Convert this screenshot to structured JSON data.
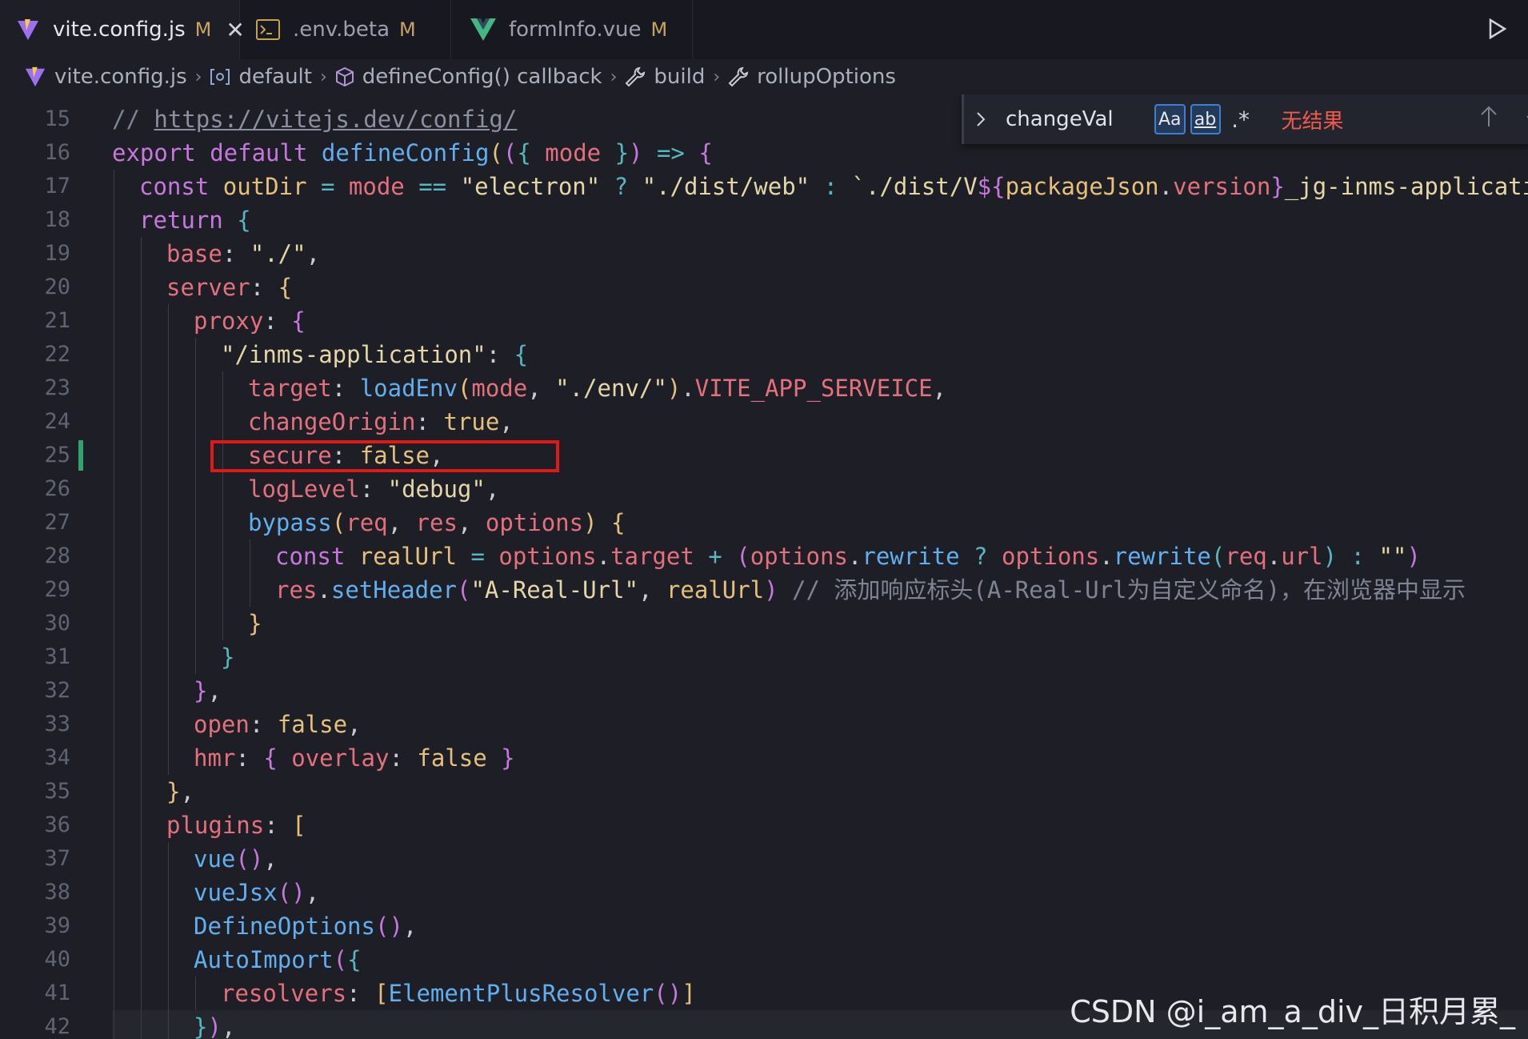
{
  "tabs": [
    {
      "label": "vite.config.js",
      "status": "M",
      "active": true,
      "icon": "vite-icon",
      "closable": true
    },
    {
      "label": ".env.beta",
      "status": "M",
      "active": false,
      "icon": "terminal-file-icon"
    },
    {
      "label": "formInfo.vue",
      "status": "M",
      "active": false,
      "icon": "vue-icon"
    }
  ],
  "breadcrumb": [
    {
      "label": "vite.config.js",
      "icon": "vite-icon"
    },
    {
      "label": "default",
      "icon": "module-icon"
    },
    {
      "label": "defineConfig() callback",
      "icon": "cube-icon"
    },
    {
      "label": "build",
      "icon": "wrench-icon"
    },
    {
      "label": "rollupOptions",
      "icon": "wrench-icon"
    }
  ],
  "find": {
    "term": "changeVal",
    "match_case": "Aa",
    "whole_word": "ab",
    "regex": ".*",
    "result": "无结果"
  },
  "lines": [
    {
      "n": "15",
      "indent": 0,
      "tokens": [
        [
          "t-cm",
          "// "
        ],
        [
          "t-url",
          "https://vitejs.dev/config/"
        ]
      ]
    },
    {
      "n": "16",
      "indent": 0,
      "tokens": [
        [
          "t-kw",
          "export "
        ],
        [
          "t-kw",
          "default "
        ],
        [
          "t-fn",
          "defineConfig"
        ],
        [
          "t-b1",
          "("
        ],
        [
          "t-b2",
          "("
        ],
        [
          "t-b3",
          "{ "
        ],
        [
          "t-prop",
          "mode"
        ],
        [
          "t-b3",
          " }"
        ],
        [
          "t-b2",
          ")"
        ],
        [
          "t-op",
          " => "
        ],
        [
          "t-b2",
          "{"
        ]
      ]
    },
    {
      "n": "17",
      "indent": 1,
      "tokens": [
        [
          "t-kw",
          "const "
        ],
        [
          "t-var",
          "outDir"
        ],
        [
          "t-op",
          " = "
        ],
        [
          "t-prop",
          "mode"
        ],
        [
          "t-op",
          " == "
        ],
        [
          "t-str",
          "\"electron\""
        ],
        [
          "t-op",
          " ? "
        ],
        [
          "t-str",
          "\"./dist/web\""
        ],
        [
          "t-op",
          " : "
        ],
        [
          "t-str",
          "`./dist/V"
        ],
        [
          "t-kw",
          "${"
        ],
        [
          "t-var",
          "packageJson"
        ],
        [
          "t-plain",
          "."
        ],
        [
          "t-prop",
          "version"
        ],
        [
          "t-kw",
          "}"
        ],
        [
          "t-str",
          "_jg-inms-application-"
        ]
      ]
    },
    {
      "n": "18",
      "indent": 1,
      "tokens": [
        [
          "t-kw",
          "return "
        ],
        [
          "t-b3",
          "{"
        ]
      ]
    },
    {
      "n": "19",
      "indent": 2,
      "tokens": [
        [
          "t-prop",
          "base"
        ],
        [
          "t-plain",
          ": "
        ],
        [
          "t-str",
          "\"./\""
        ],
        [
          "t-plain",
          ","
        ]
      ]
    },
    {
      "n": "20",
      "indent": 2,
      "tokens": [
        [
          "t-prop",
          "server"
        ],
        [
          "t-plain",
          ": "
        ],
        [
          "t-b1",
          "{"
        ]
      ]
    },
    {
      "n": "21",
      "indent": 3,
      "tokens": [
        [
          "t-prop",
          "proxy"
        ],
        [
          "t-plain",
          ": "
        ],
        [
          "t-b2",
          "{"
        ]
      ]
    },
    {
      "n": "22",
      "indent": 4,
      "tokens": [
        [
          "t-str",
          "\"/inms-application\""
        ],
        [
          "t-plain",
          ": "
        ],
        [
          "t-b3",
          "{"
        ]
      ]
    },
    {
      "n": "23",
      "indent": 5,
      "tokens": [
        [
          "t-prop",
          "target"
        ],
        [
          "t-plain",
          ": "
        ],
        [
          "t-fn",
          "loadEnv"
        ],
        [
          "t-b1",
          "("
        ],
        [
          "t-prop",
          "mode"
        ],
        [
          "t-plain",
          ", "
        ],
        [
          "t-str",
          "\"./env/\""
        ],
        [
          "t-b1",
          ")"
        ],
        [
          "t-plain",
          "."
        ],
        [
          "t-prop",
          "VITE_APP_SERVEICE"
        ],
        [
          "t-plain",
          ","
        ]
      ]
    },
    {
      "n": "24",
      "indent": 5,
      "tokens": [
        [
          "t-prop",
          "changeOrigin"
        ],
        [
          "t-plain",
          ": "
        ],
        [
          "t-bool",
          "true"
        ],
        [
          "t-plain",
          ","
        ]
      ]
    },
    {
      "n": "25",
      "indent": 5,
      "tokens": [
        [
          "t-prop",
          "secure"
        ],
        [
          "t-plain",
          ": "
        ],
        [
          "t-bool",
          "false"
        ],
        [
          "t-plain",
          ","
        ]
      ]
    },
    {
      "n": "26",
      "indent": 5,
      "tokens": [
        [
          "t-prop",
          "logLevel"
        ],
        [
          "t-plain",
          ": "
        ],
        [
          "t-str",
          "\"debug\""
        ],
        [
          "t-plain",
          ","
        ]
      ]
    },
    {
      "n": "27",
      "indent": 5,
      "tokens": [
        [
          "t-fn",
          "bypass"
        ],
        [
          "t-b1",
          "("
        ],
        [
          "t-prop",
          "req"
        ],
        [
          "t-plain",
          ", "
        ],
        [
          "t-prop",
          "res"
        ],
        [
          "t-plain",
          ", "
        ],
        [
          "t-prop",
          "options"
        ],
        [
          "t-b1",
          ")"
        ],
        [
          "t-b1",
          " {"
        ]
      ]
    },
    {
      "n": "28",
      "indent": 6,
      "tokens": [
        [
          "t-kw",
          "const "
        ],
        [
          "t-var",
          "realUrl"
        ],
        [
          "t-op",
          " = "
        ],
        [
          "t-prop",
          "options"
        ],
        [
          "t-plain",
          "."
        ],
        [
          "t-prop",
          "target"
        ],
        [
          "t-op",
          " + "
        ],
        [
          "t-b2",
          "("
        ],
        [
          "t-prop",
          "options"
        ],
        [
          "t-plain",
          "."
        ],
        [
          "t-fn",
          "rewrite"
        ],
        [
          "t-op",
          " ? "
        ],
        [
          "t-prop",
          "options"
        ],
        [
          "t-plain",
          "."
        ],
        [
          "t-fn",
          "rewrite"
        ],
        [
          "t-b3",
          "("
        ],
        [
          "t-prop",
          "req"
        ],
        [
          "t-plain",
          "."
        ],
        [
          "t-prop",
          "url"
        ],
        [
          "t-b3",
          ")"
        ],
        [
          "t-op",
          " : "
        ],
        [
          "t-str",
          "\"\""
        ],
        [
          "t-b2",
          ")"
        ]
      ]
    },
    {
      "n": "29",
      "indent": 6,
      "tokens": [
        [
          "t-prop",
          "res"
        ],
        [
          "t-plain",
          "."
        ],
        [
          "t-fn",
          "setHeader"
        ],
        [
          "t-b2",
          "("
        ],
        [
          "t-str",
          "\"A-Real-Url\""
        ],
        [
          "t-plain",
          ", "
        ],
        [
          "t-var",
          "realUrl"
        ],
        [
          "t-b2",
          ")"
        ],
        [
          "t-cm",
          " // 添加响应标头(A-Real-Url为自定义命名)，在浏览器中显示"
        ]
      ]
    },
    {
      "n": "30",
      "indent": 5,
      "tokens": [
        [
          "t-b1",
          "}"
        ]
      ]
    },
    {
      "n": "31",
      "indent": 4,
      "tokens": [
        [
          "t-b3",
          "}"
        ]
      ]
    },
    {
      "n": "32",
      "indent": 3,
      "tokens": [
        [
          "t-b2",
          "}"
        ],
        [
          "t-plain",
          ","
        ]
      ]
    },
    {
      "n": "33",
      "indent": 3,
      "tokens": [
        [
          "t-prop",
          "open"
        ],
        [
          "t-plain",
          ": "
        ],
        [
          "t-bool",
          "false"
        ],
        [
          "t-plain",
          ","
        ]
      ]
    },
    {
      "n": "34",
      "indent": 3,
      "tokens": [
        [
          "t-prop",
          "hmr"
        ],
        [
          "t-plain",
          ": "
        ],
        [
          "t-b2",
          "{ "
        ],
        [
          "t-prop",
          "overlay"
        ],
        [
          "t-plain",
          ": "
        ],
        [
          "t-bool",
          "false"
        ],
        [
          "t-b2",
          " }"
        ]
      ]
    },
    {
      "n": "35",
      "indent": 2,
      "tokens": [
        [
          "t-b1",
          "}"
        ],
        [
          "t-plain",
          ","
        ]
      ]
    },
    {
      "n": "36",
      "indent": 2,
      "tokens": [
        [
          "t-prop",
          "plugins"
        ],
        [
          "t-plain",
          ": "
        ],
        [
          "t-b1",
          "["
        ]
      ]
    },
    {
      "n": "37",
      "indent": 3,
      "tokens": [
        [
          "t-fn",
          "vue"
        ],
        [
          "t-b2",
          "()"
        ],
        [
          "t-plain",
          ","
        ]
      ]
    },
    {
      "n": "38",
      "indent": 3,
      "tokens": [
        [
          "t-fn",
          "vueJsx"
        ],
        [
          "t-b2",
          "()"
        ],
        [
          "t-plain",
          ","
        ]
      ]
    },
    {
      "n": "39",
      "indent": 3,
      "tokens": [
        [
          "t-fn",
          "DefineOptions"
        ],
        [
          "t-b2",
          "()"
        ],
        [
          "t-plain",
          ","
        ]
      ]
    },
    {
      "n": "40",
      "indent": 3,
      "tokens": [
        [
          "t-fn",
          "AutoImport"
        ],
        [
          "t-b2",
          "("
        ],
        [
          "t-b3",
          "{"
        ]
      ]
    },
    {
      "n": "41",
      "indent": 4,
      "tokens": [
        [
          "t-prop",
          "resolvers"
        ],
        [
          "t-plain",
          ": "
        ],
        [
          "t-b1",
          "["
        ],
        [
          "t-fn",
          "ElementPlusResolver"
        ],
        [
          "t-b2",
          "()"
        ],
        [
          "t-b1",
          "]"
        ]
      ]
    },
    {
      "n": "42",
      "indent": 3,
      "tokens": [
        [
          "t-b3",
          "}"
        ],
        [
          "t-b2",
          ")"
        ],
        [
          "t-plain",
          ","
        ]
      ]
    }
  ],
  "watermark": "CSDN @i_am_a_div_日积月累_",
  "colors": {
    "accent": "#3e7fcf",
    "modified": "#c7a463",
    "highlight": "#e01818",
    "gutter_added": "#2ea56f"
  }
}
